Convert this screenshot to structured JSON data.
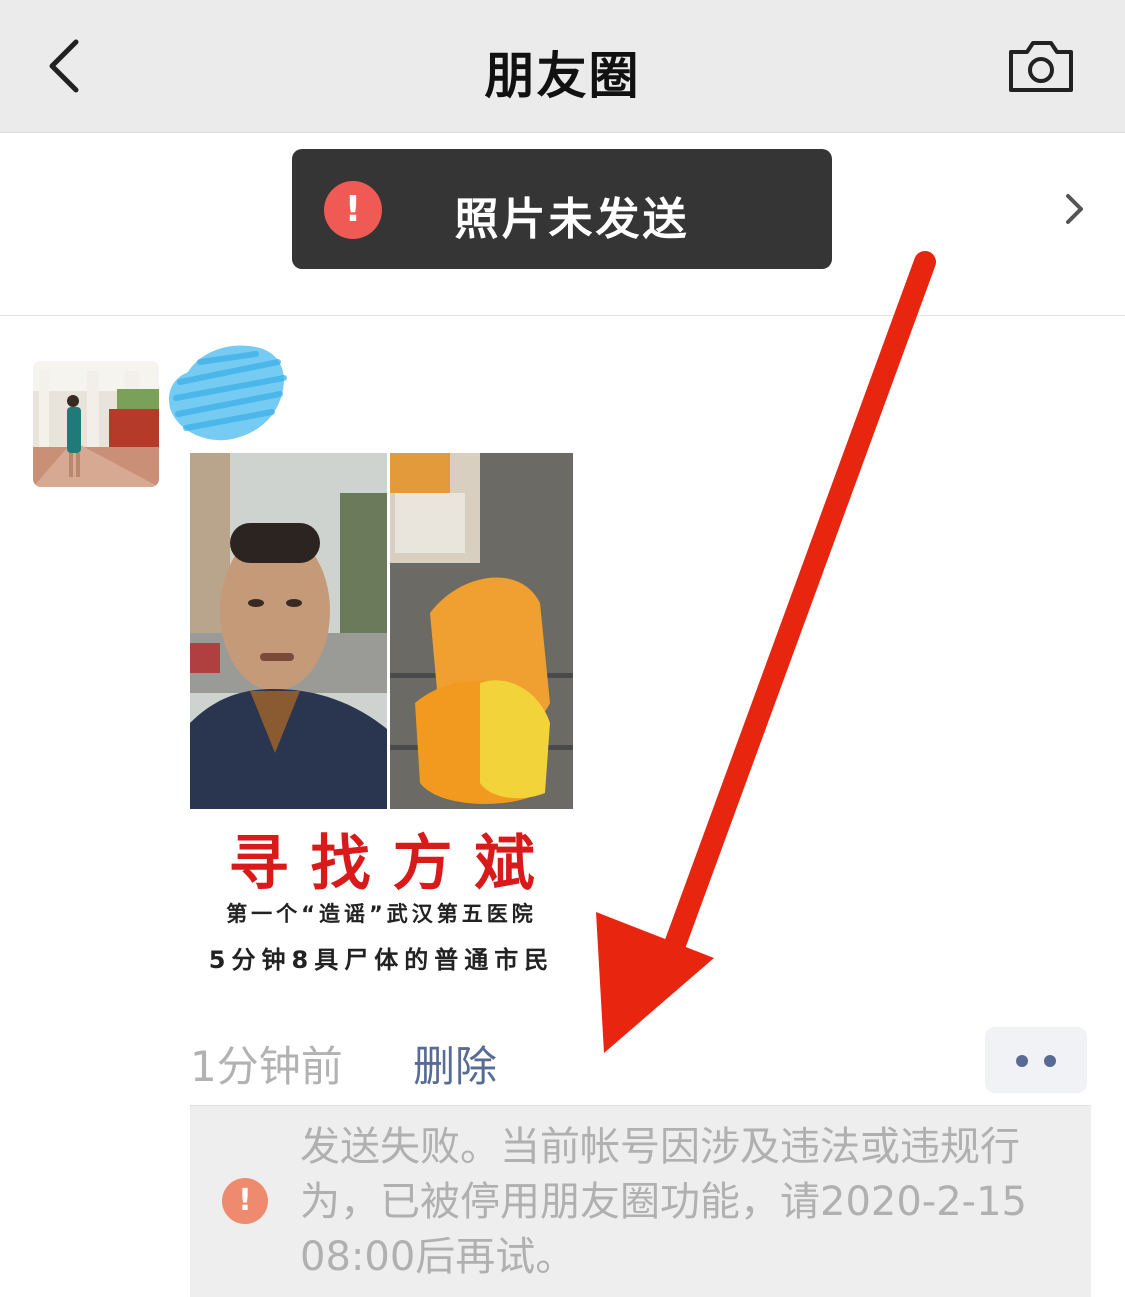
{
  "navbar": {
    "title": "朋友圈",
    "back_icon": "chevron-left-icon",
    "camera_icon": "camera-icon"
  },
  "toast": {
    "text": "照片未发送",
    "icon": "exclamation-icon",
    "chevron": "chevron-right-icon"
  },
  "post": {
    "poster": {
      "title": "寻找方斌",
      "line1": "第一个“造谣”武汉第五医院",
      "line2": "5分钟8具尸体的普通市民"
    },
    "time": "1分钟前",
    "delete_label": "删除",
    "more_icon": "more-dots-icon"
  },
  "error": {
    "icon": "exclamation-icon",
    "message": "发送失败。当前帐号因涉及违法或违规行为，已被停用朋友圈功能，请2020-2-15 08:00后再试。"
  },
  "colors": {
    "navbar_bg": "#ebebeb",
    "toast_bg": "#353535",
    "toast_icon": "#f05a55",
    "link": "#576b95",
    "muted_text": "#b2b2b2",
    "error_panel_bg": "#eeeeee",
    "error_icon": "#ee8a6d",
    "annotation_arrow": "#e8250f",
    "name_scribble": "#5ec2f0"
  }
}
